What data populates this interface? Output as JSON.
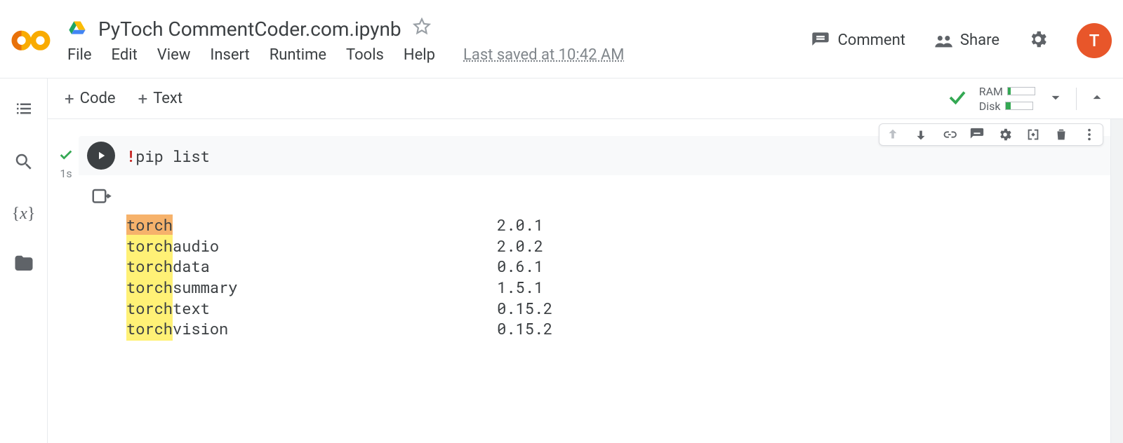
{
  "header": {
    "notebook_title": "PyToch CommentCoder.com.ipynb",
    "menu": {
      "file": "File",
      "edit": "Edit",
      "view": "View",
      "insert": "Insert",
      "runtime": "Runtime",
      "tools": "Tools",
      "help": "Help"
    },
    "last_saved": "Last saved at 10:42 AM",
    "actions": {
      "comment": "Comment",
      "share": "Share"
    },
    "avatar_letter": "T"
  },
  "toolbar": {
    "code_label": "Code",
    "text_label": "Text",
    "resources": {
      "ram_label": "RAM",
      "ram_pct": 10,
      "disk_label": "Disk",
      "disk_pct": 20
    }
  },
  "cell": {
    "exec_time": "1s",
    "code_prefix": "!",
    "code_body": "pip list",
    "output_packages": [
      {
        "name": "torch",
        "highlight_prefix": "torch",
        "highlight_style": "orange",
        "suffix": "",
        "version": "2.0.1"
      },
      {
        "name": "torchaudio",
        "highlight_prefix": "torch",
        "highlight_style": "yellow",
        "suffix": "audio",
        "version": "2.0.2"
      },
      {
        "name": "torchdata",
        "highlight_prefix": "torch",
        "highlight_style": "yellow",
        "suffix": "data",
        "version": "0.6.1"
      },
      {
        "name": "torchsummary",
        "highlight_prefix": "torch",
        "highlight_style": "yellow",
        "suffix": "summary",
        "version": "1.5.1"
      },
      {
        "name": "torchtext",
        "highlight_prefix": "torch",
        "highlight_style": "yellow",
        "suffix": "text",
        "version": "0.15.2"
      },
      {
        "name": "torchvision",
        "highlight_prefix": "torch",
        "highlight_style": "yellow",
        "suffix": "vision",
        "version": "0.15.2"
      }
    ]
  }
}
